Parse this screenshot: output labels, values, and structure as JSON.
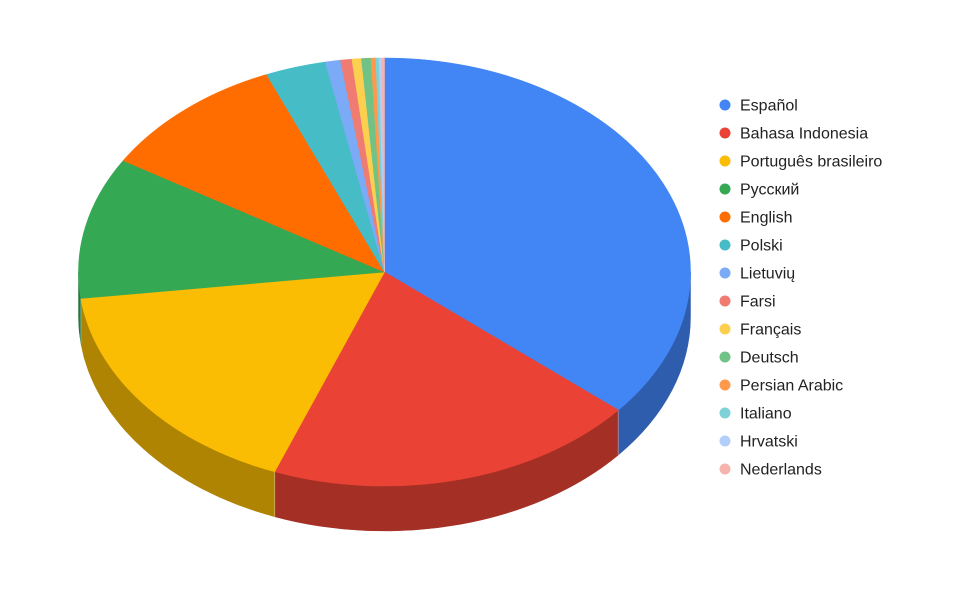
{
  "chart_data": {
    "type": "pie",
    "variant": "3d",
    "title": "",
    "legend_position": "right",
    "start_angle": "top, clockwise",
    "slices": [
      {
        "label": "Español",
        "value": 36.2,
        "color": "#4285F4",
        "side_color": "#2F5DAE"
      },
      {
        "label": "Bahasa Indonesia",
        "value": 19.7,
        "color": "#EA4335",
        "side_color": "#A42F25"
      },
      {
        "label": "Português brasileiro",
        "value": 17.2,
        "color": "#FBBC04",
        "side_color": "#B08403"
      },
      {
        "label": "Русский",
        "value": 10.7,
        "color": "#34A853",
        "side_color": "#24763A"
      },
      {
        "label": "English",
        "value": 10.0,
        "color": "#FF6D01",
        "side_color": "#B34C01"
      },
      {
        "label": "Polski",
        "value": 3.2,
        "color": "#46BDC6",
        "side_color": "#31848B"
      },
      {
        "label": "Lietuvių",
        "value": 0.8,
        "color": "#7BAAF7",
        "side_color": "#5677AD"
      },
      {
        "label": "Farsi",
        "value": 0.6,
        "color": "#F07B72",
        "side_color": "#A85650"
      },
      {
        "label": "Français",
        "value": 0.5,
        "color": "#FCD04F",
        "side_color": "#B09237"
      },
      {
        "label": "Deutsch",
        "value": 0.5,
        "color": "#71C287",
        "side_color": "#4F885F"
      },
      {
        "label": "Persian Arabic",
        "value": 0.25,
        "color": "#FF994D",
        "side_color": "#B36B36"
      },
      {
        "label": "Italiano",
        "value": 0.17,
        "color": "#7ED1D7",
        "side_color": "#589297"
      },
      {
        "label": "Hrvatski",
        "value": 0.14,
        "color": "#B3CEFB",
        "side_color": "#7D90B0"
      },
      {
        "label": "Nederlands",
        "value": 0.14,
        "color": "#F7B4AE",
        "side_color": "#AD7E7A"
      }
    ]
  }
}
